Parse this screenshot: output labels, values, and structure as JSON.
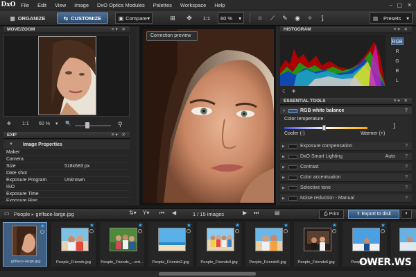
{
  "app": {
    "logo": "DxO"
  },
  "menu": [
    "File",
    "Edit",
    "View",
    "Image",
    "DxO Optics Modules",
    "Palettes",
    "Workspace",
    "Help"
  ],
  "toolbar": {
    "organize": "ORGANIZE",
    "customize": "CUSTOMIZE",
    "compare": "Compare",
    "zoom_1_1": "1:1",
    "zoom_value": "60 %",
    "presets": "Presets"
  },
  "left": {
    "move_zoom_title": "MOVE/ZOOM",
    "nav_zoom_1_1": "1:1",
    "nav_zoom_value": "60 %",
    "exif_title": "EXIF",
    "image_properties": "Image Properties",
    "exif_rows": [
      {
        "k": "Maker",
        "v": ""
      },
      {
        "k": "Camera",
        "v": ""
      },
      {
        "k": "Size",
        "v": "518x683 px"
      },
      {
        "k": "Date shot",
        "v": ""
      },
      {
        "k": "Exposure Program",
        "v": "Unknown"
      },
      {
        "k": "ISO",
        "v": ""
      },
      {
        "k": "Exposure Time",
        "v": ""
      },
      {
        "k": "Exposure Bias",
        "v": ""
      }
    ]
  },
  "center": {
    "tooltip": "Correction preview"
  },
  "right": {
    "histogram_title": "HISTOGRAM",
    "channels": [
      "RGB",
      "R",
      "G",
      "B",
      "L"
    ],
    "essential_tools_title": "ESSENTIAL TOOLS",
    "wb_title": "RGB white balance",
    "color_temperature": "Color temperature:",
    "cooler": "Cooler (-)",
    "warmer": "Warmer (+)",
    "tools": [
      {
        "label": "Exposure compensation",
        "value": ""
      },
      {
        "label": "DxO Smart Lighting",
        "value": "Auto"
      },
      {
        "label": "Contrast",
        "value": ""
      },
      {
        "label": "Color accentuation",
        "value": ""
      },
      {
        "label": "Selective tone",
        "value": ""
      },
      {
        "label": "Noise reduction - Manual",
        "value": ""
      }
    ],
    "help": "?"
  },
  "browser": {
    "folder": "People",
    "file": "girlface-large.jpg",
    "page_info": "1 / 15",
    "page_unit": "images",
    "print": "Print",
    "export": "Export to disk",
    "thumbnails": [
      "girlface-large.jpg",
      "People_Friends.jpg",
      "People_Friends_...ent...",
      "People_Friends2.jpg",
      "People_Friends4.jpg",
      "People_Friends5.jpg",
      "People_Friends6.jpg",
      "People_Frien..."
    ]
  },
  "watermark": "OWER.WS",
  "colors": {
    "accent": "#3e5e82",
    "accent_border": "#7aa0c8",
    "star": "#3ab0ff"
  }
}
